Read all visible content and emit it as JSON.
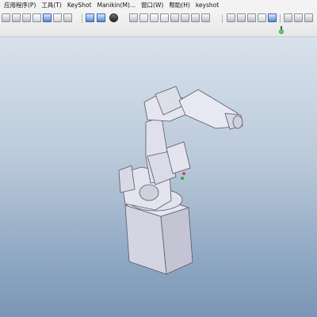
{
  "menu": {
    "items": [
      "应用程序(P)",
      "工具(T)",
      "KeyShot",
      "Manikin(M)...",
      "窗口(W)",
      "帮助(H)",
      "keyshot"
    ]
  },
  "toolbar": {
    "icons": [
      "new-icon",
      "open-icon",
      "copy-icon",
      "paste-icon",
      "regenerate-icon",
      "find-icon",
      "select-box-icon",
      "view-manager-icon",
      "fit-icon",
      "render-style-icon",
      "pan-icon",
      "zoom-in-icon",
      "zoom-out-icon",
      "zoom-window-icon",
      "rotate-icon",
      "saved-views-icon",
      "wireframe-icon",
      "hidden-line-icon",
      "no-hidden-icon",
      "shaded-icon",
      "shaded-edges-icon",
      "datum-plane-icon",
      "datum-axis-icon",
      "datum-point-icon",
      "coordinate-system-icon"
    ]
  },
  "colors": {
    "background_top": "#d8e2ec",
    "background_bottom": "#7b96b6",
    "model_fill": "#dcdcea",
    "model_edge": "#585868"
  }
}
